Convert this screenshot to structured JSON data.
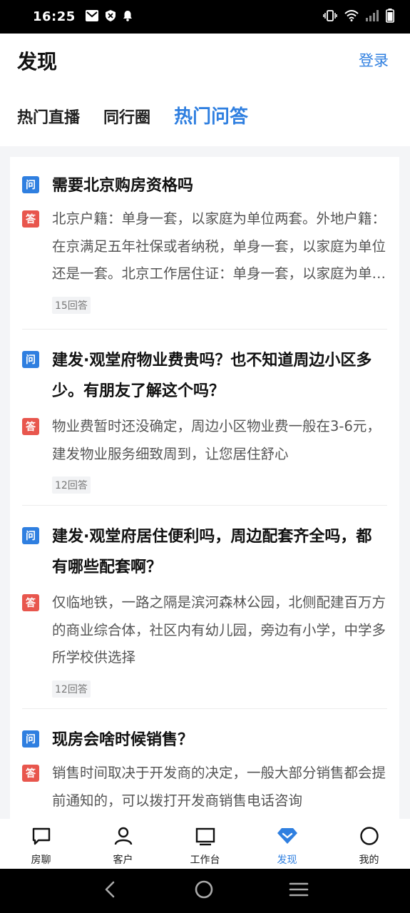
{
  "status_bar": {
    "time": "16:25"
  },
  "header": {
    "title": "发现",
    "login": "登录",
    "tabs": [
      {
        "label": "热门直播",
        "active": false
      },
      {
        "label": "同行圈",
        "active": false
      },
      {
        "label": "热门问答",
        "active": true
      }
    ]
  },
  "qa": {
    "q_badge": "问",
    "a_badge": "答",
    "items": [
      {
        "question": "需要北京购房资格吗",
        "answer": "北京户籍：单身一套，以家庭为单位两套。外地户籍：在京满足五年社保或者纳税，单身一套，以家庭为单位还是一套。北京工作居住证：单身一套，以家庭为单位一套。",
        "answer_count": "15回答"
      },
      {
        "question": "建发·观堂府物业费贵吗？也不知道周边小区多少。有朋友了解这个吗？",
        "answer": "物业费暂时还没确定，周边小区物业费一般在3-6元，建发物业服务细致周到，让您居住舒心",
        "answer_count": "12回答"
      },
      {
        "question": "建发·观堂府居住便利吗，周边配套齐全吗，都有哪些配套啊？",
        "answer": "仅临地铁，一路之隔是滨河森林公园，北侧配建百万方的商业综合体，社区内有幼儿园，旁边有小学，中学多所学校供选择",
        "answer_count": "12回答"
      },
      {
        "question": "现房会啥时候销售？",
        "answer": "销售时间取决于开发商的决定，一般大部分销售都会提前通知的，可以拨打开发商销售电话咨询",
        "answer_count": ""
      }
    ]
  },
  "bottom_nav": [
    {
      "label": "房聊",
      "icon": "chat-icon",
      "active": false
    },
    {
      "label": "客户",
      "icon": "person-icon",
      "active": false
    },
    {
      "label": "工作台",
      "icon": "monitor-icon",
      "active": false
    },
    {
      "label": "发现",
      "icon": "diamond-icon",
      "active": true
    },
    {
      "label": "我的",
      "icon": "circle-icon",
      "active": false
    }
  ],
  "colors": {
    "accent": "#2f7fe0",
    "answer_badge": "#e8564d"
  }
}
